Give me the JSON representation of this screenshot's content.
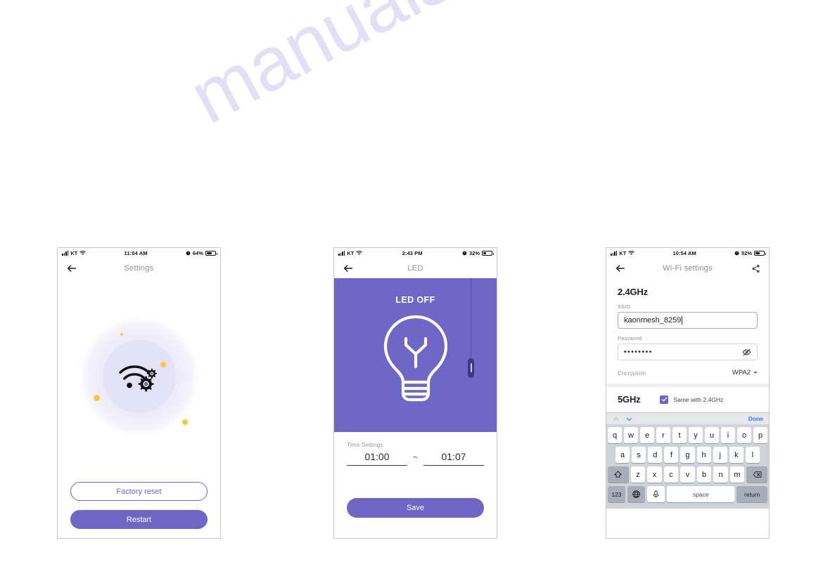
{
  "watermark": "manualshive.com",
  "colors": {
    "accent_purple": "#6f67c6",
    "dot_yellow": "#fdc836",
    "ios_blue": "#2e7cf6",
    "label_gray": "#8d8d97"
  },
  "screens": [
    {
      "id": "settings",
      "status_bar": {
        "carrier": "KT",
        "time": "11:04 AM",
        "battery": "64%"
      },
      "nav": {
        "title": "Settings",
        "back_icon": "arrow-left-icon"
      },
      "hero_icon": "wifi-gear-icon",
      "buttons": [
        {
          "label": "Factory reset",
          "style": "outline"
        },
        {
          "label": "Restart",
          "style": "solid"
        }
      ]
    },
    {
      "id": "led",
      "status_bar": {
        "carrier": "KT",
        "time": "2:43 PM",
        "battery": "32%"
      },
      "nav": {
        "title": "LED",
        "back_icon": "arrow-left-icon"
      },
      "hero": {
        "state_label": "LED OFF",
        "icon": "light-bulb-icon",
        "cord_icon": "pull-cord-icon"
      },
      "time_settings": {
        "label": "Time Settings",
        "start": "01:00",
        "separator": "~",
        "end": "01:07"
      },
      "save_label": "Save"
    },
    {
      "id": "wifi-settings",
      "status_bar": {
        "carrier": "KT",
        "time": "10:54 AM",
        "battery": "52%"
      },
      "nav": {
        "title": "Wi-Fi settings",
        "back_icon": "arrow-left-icon",
        "share_icon": "share-icon"
      },
      "band_24": {
        "title": "2.4GHz",
        "ssid_label": "SSID",
        "ssid_value": "kaonmesh_8259",
        "password_label": "Password",
        "password_value": "••••••••",
        "password_toggle_icon": "eye-off-icon",
        "encryption_label": "Encryption",
        "encryption_value": "WPA2"
      },
      "band_5": {
        "title": "5GHz",
        "same_label": "Same with 2.4GHz",
        "same_checked": true
      },
      "keyboard": {
        "prev_icon": "chevron-up-icon",
        "next_icon": "chevron-down-icon",
        "done_label": "Done",
        "row1": [
          "q",
          "w",
          "e",
          "r",
          "t",
          "y",
          "u",
          "i",
          "o",
          "p"
        ],
        "row2": [
          "a",
          "s",
          "d",
          "f",
          "g",
          "h",
          "j",
          "k",
          "l"
        ],
        "row3": [
          "z",
          "x",
          "c",
          "v",
          "b",
          "n",
          "m"
        ],
        "shift_icon": "shift-icon",
        "backspace_icon": "backspace-icon",
        "numbers_label": "123",
        "globe_icon": "globe-icon",
        "mic_icon": "microphone-icon",
        "space_label": "space",
        "return_label": "return"
      }
    }
  ]
}
